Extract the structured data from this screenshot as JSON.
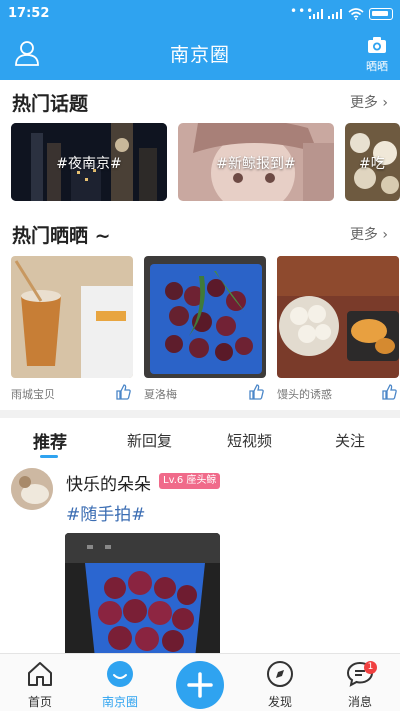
{
  "status_bar": {
    "time": "17:52"
  },
  "header": {
    "title": "南京圈",
    "camera_label": "晒晒"
  },
  "hot_topics": {
    "title": "热门话题",
    "more": "更多",
    "items": [
      {
        "tag": "#夜南京#"
      },
      {
        "tag": "#新鲸报到#"
      },
      {
        "tag": "#吃"
      }
    ]
  },
  "hot_shares": {
    "title": "热门晒晒 ~",
    "more": "更多",
    "items": [
      {
        "caption": "雨城宝贝"
      },
      {
        "caption": "夏洛梅"
      },
      {
        "caption": "馒头的诱惑"
      }
    ]
  },
  "feed_tabs": [
    {
      "label": "推荐"
    },
    {
      "label": "新回复"
    },
    {
      "label": "短视频"
    },
    {
      "label": "关注"
    }
  ],
  "post": {
    "username": "快乐的朵朵",
    "level": "Lv.6 座头鲸",
    "tag": "#随手拍#"
  },
  "bottom_nav": {
    "items": [
      {
        "label": "首页"
      },
      {
        "label": "南京圈"
      },
      {
        "label": "发现"
      },
      {
        "label": "消息"
      }
    ],
    "message_badge": "1"
  },
  "colors": {
    "accent": "#2fa3f0",
    "badge": "#f04040",
    "level_badge": "#f06a8a",
    "tag_link": "#3b6db3"
  }
}
